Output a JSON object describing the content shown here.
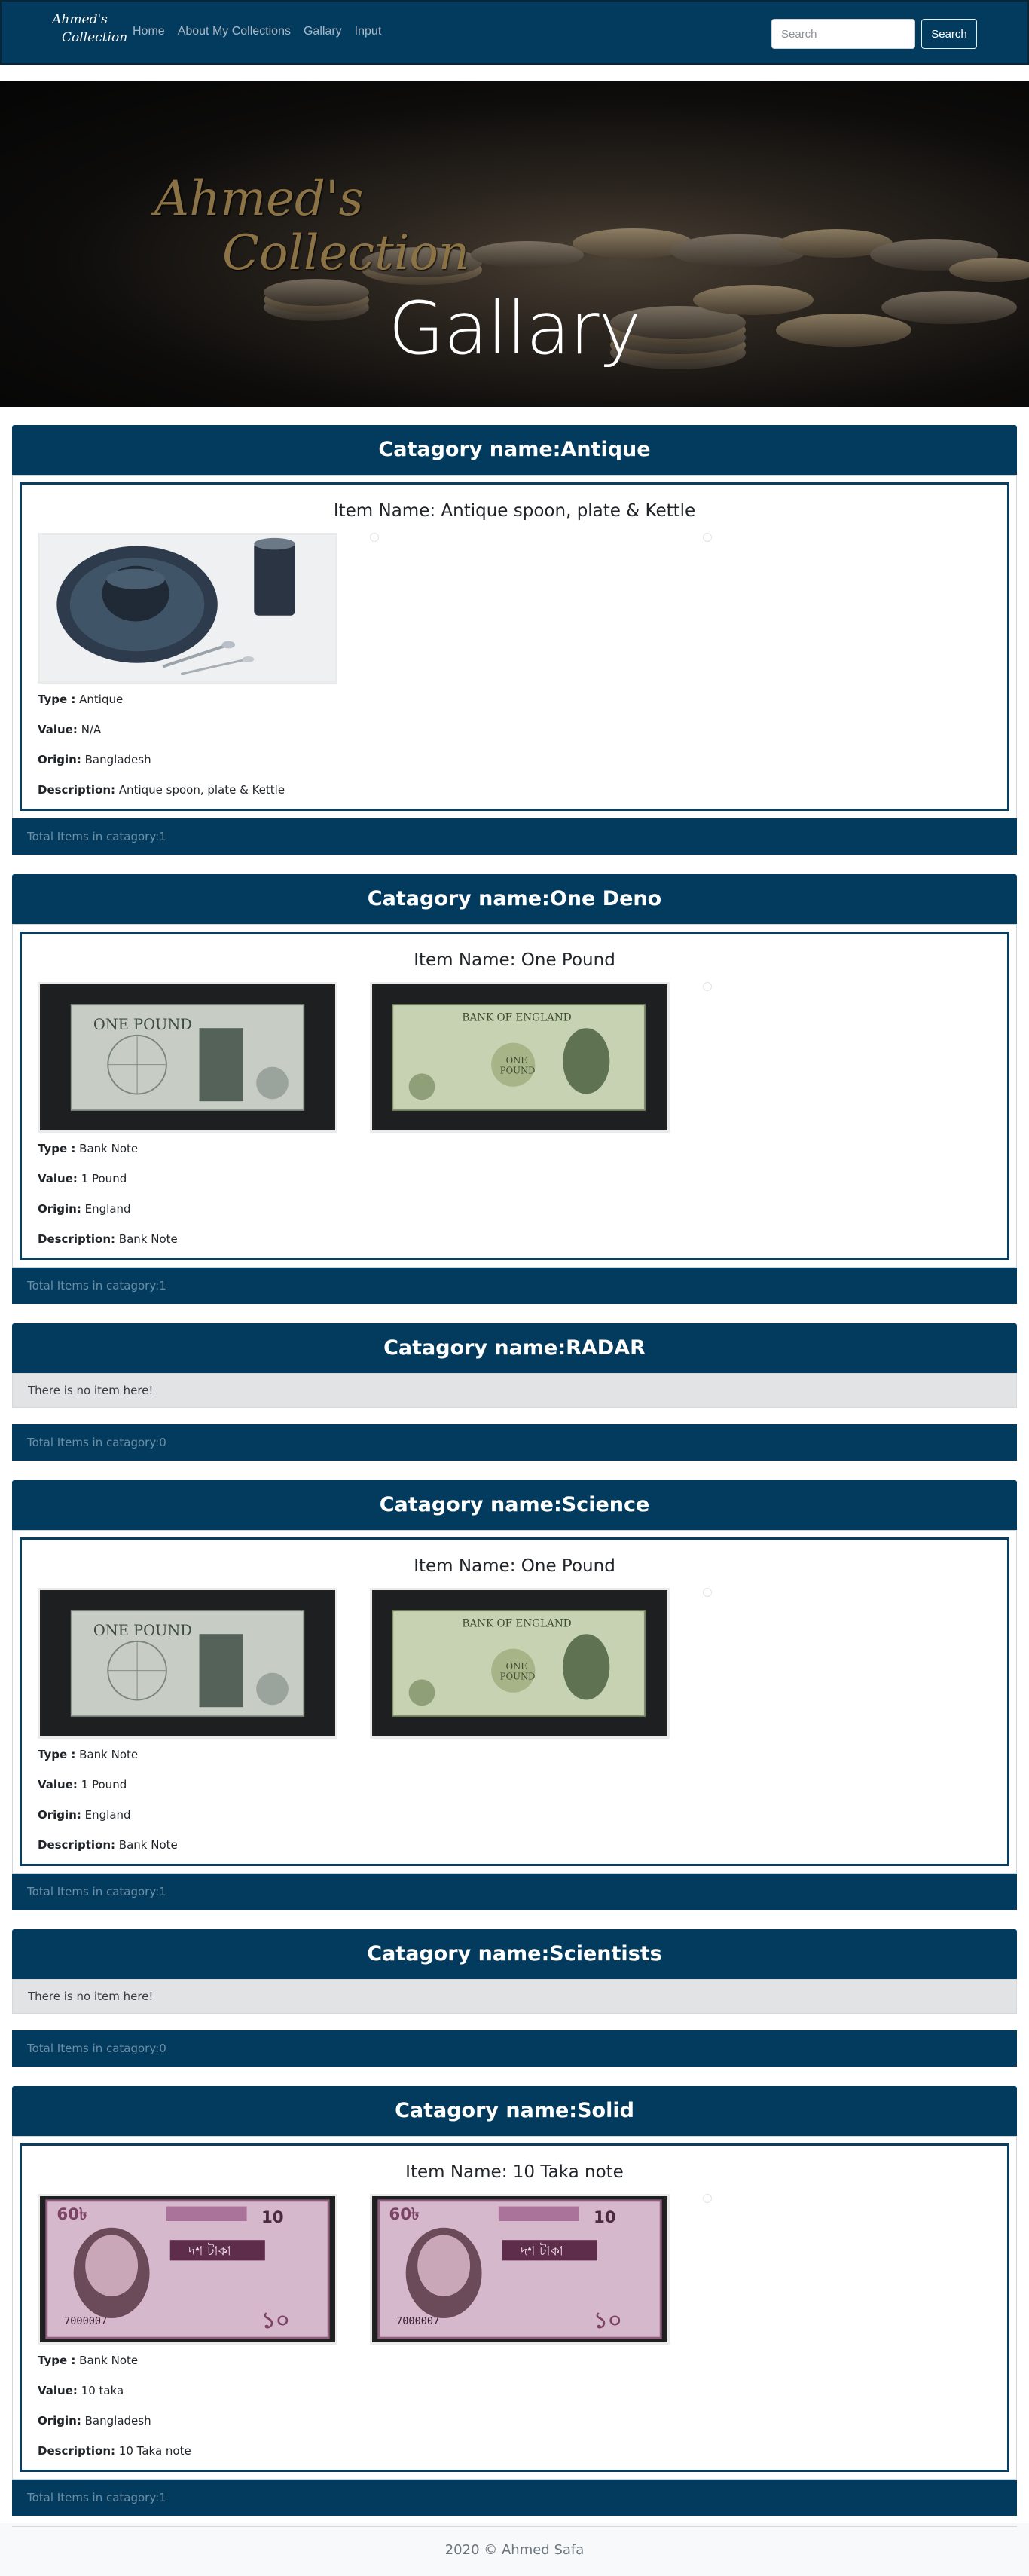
{
  "navbar": {
    "brand_line1": "Ahmed's",
    "brand_line2": "Collection",
    "links": [
      "Home",
      "About My Collections",
      "Gallary",
      "Input"
    ],
    "search_placeholder": "Search",
    "search_button": "Search",
    "bg_color": "#033b5e"
  },
  "hero": {
    "logo_line1": "Ahmed's",
    "logo_line2": "Collection",
    "title": "Gallary"
  },
  "categories": [
    {
      "header": "Catagory name:Antique",
      "item": {
        "title": "Item Name: Antique spoon, plate & Kettle",
        "images": [
          "antique-photo"
        ],
        "type_label": "Type :",
        "type": "Antique",
        "value_label": "Value:",
        "value": "N/A",
        "origin_label": "Origin:",
        "origin": "Bangladesh",
        "description_label": "Description:",
        "description": "Antique spoon, plate & Kettle"
      },
      "footer": "Total Items in catagory:1"
    },
    {
      "header": "Catagory name:One Deno",
      "item": {
        "title": "Item Name: One Pound",
        "images": [
          "one-pound-back",
          "one-pound-front"
        ],
        "type_label": "Type :",
        "type": "Bank Note",
        "value_label": "Value:",
        "value": "1 Pound",
        "origin_label": "Origin:",
        "origin": "England",
        "description_label": "Description:",
        "description": "Bank Note"
      },
      "footer": "Total Items in catagory:1"
    },
    {
      "header": "Catagory name:RADAR",
      "empty_message": "There is no item here!",
      "footer": "Total Items in catagory:0"
    },
    {
      "header": "Catagory name:Science",
      "item": {
        "title": "Item Name: One Pound",
        "images": [
          "one-pound-back",
          "one-pound-front"
        ],
        "type_label": "Type :",
        "type": "Bank Note",
        "value_label": "Value:",
        "value": "1 Pound",
        "origin_label": "Origin:",
        "origin": "England",
        "description_label": "Description:",
        "description": "Bank Note"
      },
      "footer": "Total Items in catagory:1"
    },
    {
      "header": "Catagory name:Scientists",
      "empty_message": "There is no item here!",
      "footer": "Total Items in catagory:0"
    },
    {
      "header": "Catagory name:Solid",
      "item": {
        "title": "Item Name: 10 Taka note",
        "images": [
          "ten-taka-front",
          "ten-taka-front"
        ],
        "type_label": "Type :",
        "type": "Bank Note",
        "value_label": "Value:",
        "value": "10 taka",
        "origin_label": "Origin:",
        "origin": "Bangladesh",
        "description_label": "Description:",
        "description": "10 Taka note"
      },
      "footer": "Total Items in catagory:1"
    }
  ],
  "footer": {
    "copyright": "2020 © Ahmed Safa"
  }
}
